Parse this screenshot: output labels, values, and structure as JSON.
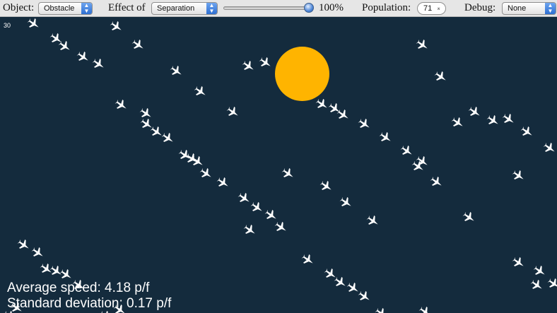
{
  "toolbar": {
    "object_label": "Object:",
    "object_value": "Obstacle",
    "effect_label": "Effect of",
    "effect_value": "Separation",
    "slider_percent": "100%",
    "slider_fraction": 1.0,
    "population_label": "Population:",
    "population_value": "71",
    "debug_label": "Debug:",
    "debug_value": "None"
  },
  "canvas": {
    "frame_counter": "30",
    "average_speed": "Average speed: 4.18 p/f",
    "standard_deviation": "Standard deviation: 0.17 p/f",
    "background_color": "#142b3d",
    "obstacle_color": "#ffb400",
    "bird_color": "#ffffff"
  }
}
